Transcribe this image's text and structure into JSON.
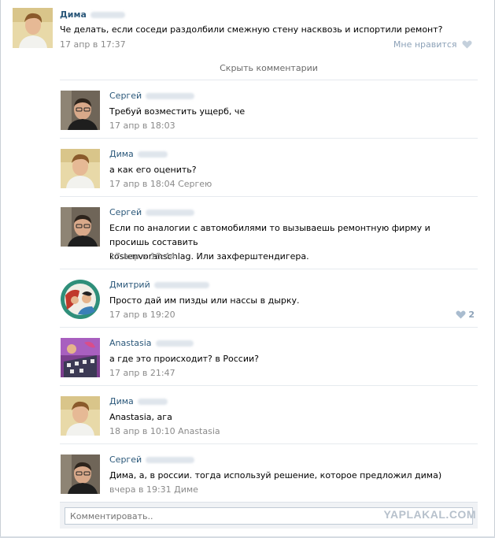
{
  "post": {
    "author": "Дима",
    "text": "Че делать, если соседи раздолбили смежную стену насквозь и испортили ремонт?",
    "date": "17 апр в 17:37",
    "like_label": "Мне нравится"
  },
  "hide_comments_label": "Скрыть комментарии",
  "comments": [
    {
      "author": "Сергей",
      "text": "Требуй возместить ущерб, че",
      "meta": "17 апр в 18:03"
    },
    {
      "author": "Дима",
      "text": "а как его оценить?",
      "meta": "17 апр в 18:04 Сергею"
    },
    {
      "author": "Сергей",
      "text_line1": "Если по аналогии с автомобилями то вызываешь ремонтную фирму и просишь составить",
      "text_line2": "kostenvoranschlag. Или захферштендигера.",
      "meta": "17 апр в 18:44"
    },
    {
      "author": "Дмитрий",
      "text": "Просто дай им пизды или нассы в дырку.",
      "meta": "17 апр в 19:20",
      "likes": "2"
    },
    {
      "author": "Anastasia",
      "text": "а где это происходит? в России?",
      "meta": "17 апр в 21:47"
    },
    {
      "author": "Дима",
      "text": "Anastasia, ага",
      "meta": "18 апр в 10:10 Anastasia"
    },
    {
      "author": "Сергей",
      "text": "Дима, а, в россии. тогда используй решение, которое предложил дима)",
      "meta": "вчера в 19:31 Диме"
    }
  ],
  "reply": {
    "placeholder": "Комментировать.."
  },
  "watermark": "YAPLAKAL.COM",
  "icons": {
    "like": "heart-icon"
  },
  "colors": {
    "link": "#2b587a",
    "meta": "#8a8a8a",
    "like": "#8da2b8"
  }
}
